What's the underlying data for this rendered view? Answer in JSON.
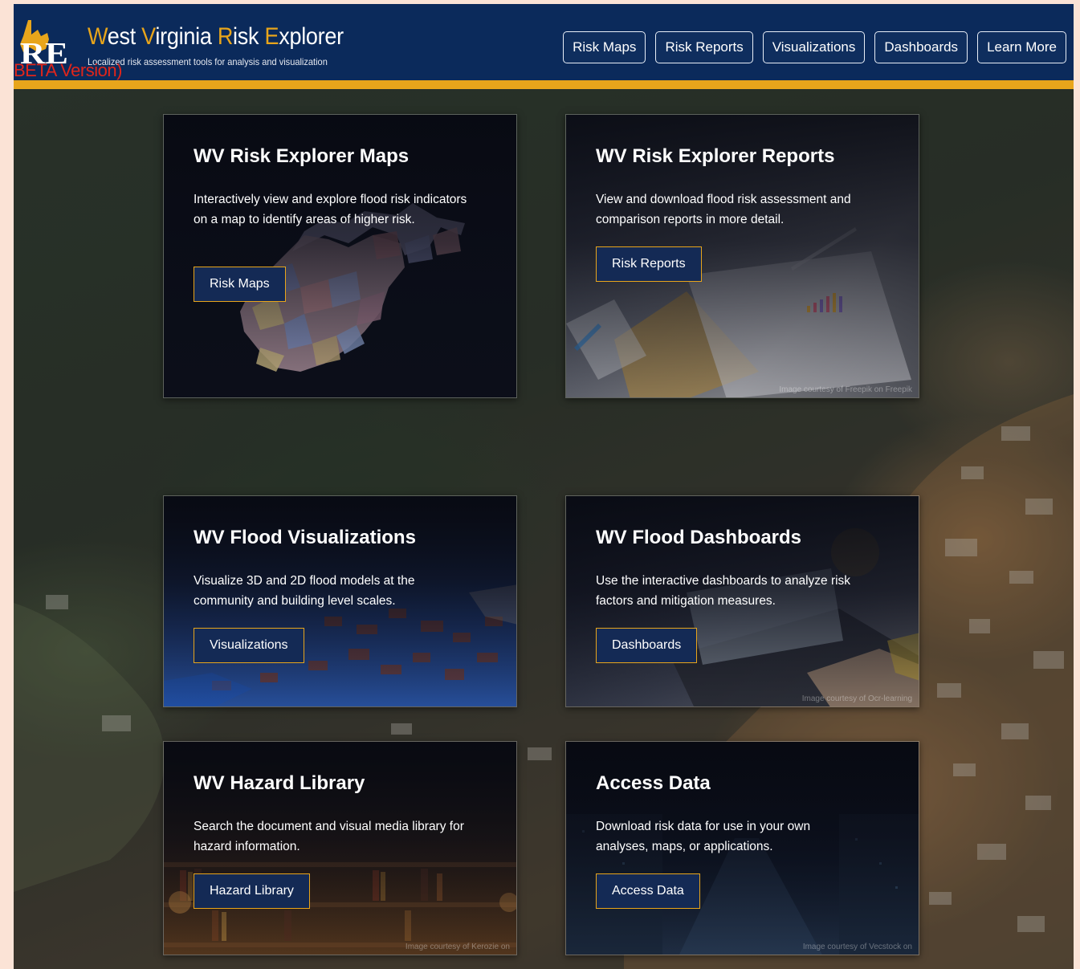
{
  "header": {
    "title": {
      "w": "W",
      "est": "est ",
      "v": "V",
      "irginia": "irginia ",
      "r": "R",
      "isk": "isk ",
      "e": "E",
      "xplorer": "xplorer"
    },
    "subtitle": "Localized risk assessment tools for analysis and visualization",
    "logo_letters": "RE",
    "beta_label": "BETA Version)",
    "nav": [
      {
        "label": "Risk Maps"
      },
      {
        "label": "Risk Reports"
      },
      {
        "label": "Visualizations"
      },
      {
        "label": "Dashboards"
      },
      {
        "label": "Learn More"
      }
    ]
  },
  "cards": [
    {
      "title": "WV Risk Explorer Maps",
      "description": "Interactively view and explore flood risk indicators on a map to identify areas of higher risk.",
      "button": "Risk Maps",
      "credit": ""
    },
    {
      "title": "WV Risk Explorer Reports",
      "description": "View and download flood risk assessment and comparison reports in more detail.",
      "button": "Risk Reports",
      "credit": "Image courtesy of Freepik on Freepik"
    },
    {
      "title": "WV Flood Visualizations",
      "description": "Visualize 3D and 2D flood models at the community and building level scales.",
      "button": "Visualizations",
      "credit": ""
    },
    {
      "title": "WV Flood Dashboards",
      "description": "Use the interactive dashboards to analyze risk factors and mitigation measures.",
      "button": "Dashboards",
      "credit": "Image courtesy of Ocr-learning"
    },
    {
      "title": "WV Hazard Library",
      "description": "Search the document and visual media library for hazard information.",
      "button": "Hazard Library",
      "credit": "Image courtesy of Kerozie on"
    },
    {
      "title": "Access Data",
      "description": "Download risk data for use in your own analyses, maps, or applications.",
      "button": "Access Data",
      "credit": "Image courtesy of Vecstock on"
    }
  ],
  "colors": {
    "header_bg": "#0b2a5b",
    "accent_gold": "#e8a51b",
    "beta_red": "#e0251b",
    "button_bg": "#142a55"
  }
}
